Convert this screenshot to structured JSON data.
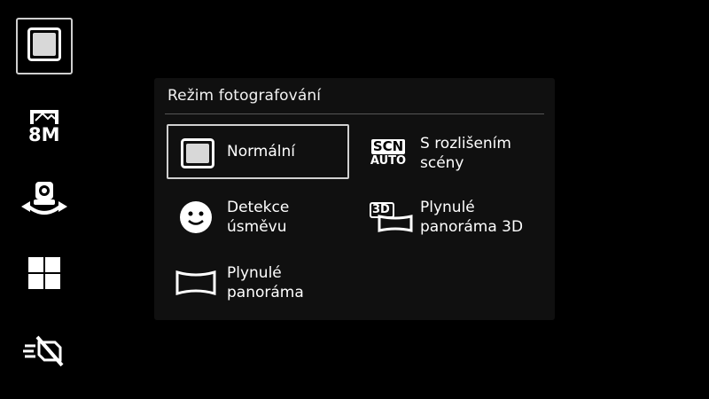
{
  "sidebar": {
    "items": [
      {
        "name": "shooting-mode"
      },
      {
        "name": "resolution",
        "label": "8M"
      },
      {
        "name": "self-shot"
      },
      {
        "name": "scene-grid"
      },
      {
        "name": "flash-off"
      }
    ]
  },
  "panel": {
    "title": "Režim fotografování",
    "options": [
      {
        "label": "Normální",
        "selected": true
      },
      {
        "label": "S rozlišením\nscény",
        "icon_text_top": "SCN",
        "icon_text_bottom": "AUTO"
      },
      {
        "label": "Detekce\núsměvu"
      },
      {
        "label": "Plynulé\npanoráma 3D",
        "icon_text_top": "3D"
      },
      {
        "label": "Plynulé\npanoráma"
      }
    ]
  }
}
